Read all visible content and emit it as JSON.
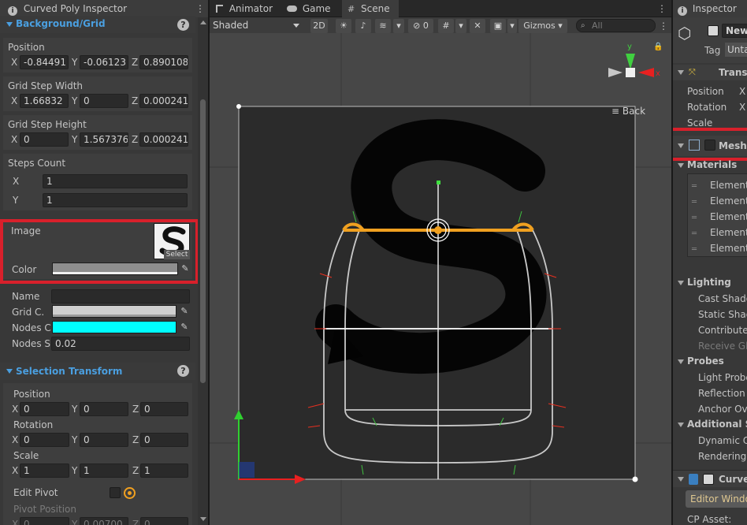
{
  "left_panel": {
    "tab_title": "Curved Poly Inspector",
    "menu_icon": "kebab-menu-icon",
    "background_grid": {
      "header": "Background/Grid",
      "position": {
        "label": "Position",
        "x": "-0.84491",
        "y": "-0.06123",
        "z": "0.890108"
      },
      "grid_step_width": {
        "label": "Grid Step Width",
        "x": "1.66832",
        "y": "0",
        "z": "0.000241"
      },
      "grid_step_height": {
        "label": "Grid Step Height",
        "x": "0",
        "y": "1.567376",
        "z": "0.000241"
      },
      "steps_count": {
        "label": "Steps Count",
        "x": "1",
        "y": "1"
      },
      "image": {
        "label": "Image",
        "select_label": "Select"
      },
      "color": {
        "label": "Color"
      },
      "name": {
        "label": "Name",
        "value": ""
      },
      "grid_color": {
        "label": "Grid C."
      },
      "nodes_color": {
        "label": "Nodes C",
        "color": "#00ffff"
      },
      "nodes_size": {
        "label": "Nodes S.",
        "value": "0.02"
      }
    },
    "selection_transform": {
      "header": "Selection Transform",
      "position": {
        "label": "Position",
        "x": "0",
        "y": "0",
        "z": "0"
      },
      "rotation": {
        "label": "Rotation",
        "x": "0",
        "y": "0",
        "z": "0"
      },
      "scale": {
        "label": "Scale",
        "x": "1",
        "y": "1",
        "z": "1"
      },
      "edit_pivot": {
        "label": "Edit Pivot"
      },
      "pivot_position": {
        "label": "Pivot Position",
        "x": "0",
        "y": "0.00700",
        "z": "0"
      }
    },
    "axis_labels": {
      "x": "X",
      "y": "Y",
      "z": "Z"
    }
  },
  "scene": {
    "tabs": [
      {
        "label": "Animator",
        "icon": "animator-icon"
      },
      {
        "label": "Game",
        "icon": "gamepad-icon"
      },
      {
        "label": "Scene",
        "icon": "grid-icon"
      }
    ],
    "shading_mode": "Shaded",
    "mode_2d": "2D",
    "hidden_count": "0",
    "gizmos_label": "Gizmos",
    "search_placeholder": "All",
    "back_label": "Back"
  },
  "inspector": {
    "tab_title": "Inspector",
    "object_name": "New",
    "tag_label": "Tag",
    "tag_value": "Unta",
    "transform": {
      "header": "Trans",
      "rows": [
        "Position",
        "Rotation",
        "Scale"
      ],
      "axis": "X"
    },
    "mesh_header": "Mesh",
    "materials_header": "Materials",
    "elements": [
      "Element",
      "Element",
      "Element",
      "Element",
      "Element"
    ],
    "lighting_header": "Lighting",
    "lighting_rows": [
      "Cast Shado",
      "Static Shad",
      "Contribute",
      "Receive Gl"
    ],
    "probes_header": "Probes",
    "probes_rows": [
      "Light Probe",
      "Reflection",
      "Anchor Ove"
    ],
    "additional_header": "Additional Se",
    "additional_rows": [
      "Dynamic O",
      "Rendering"
    ],
    "curved_header": "Curve",
    "editor_window_btn": "Editor Windo",
    "cp_asset_label": "CP Asset:"
  },
  "colors": {
    "highlight_red": "#d8202b",
    "section_blue": "#4a9fe0",
    "selection_orange": "#f0a020",
    "nodes_cyan": "#00ffff"
  }
}
